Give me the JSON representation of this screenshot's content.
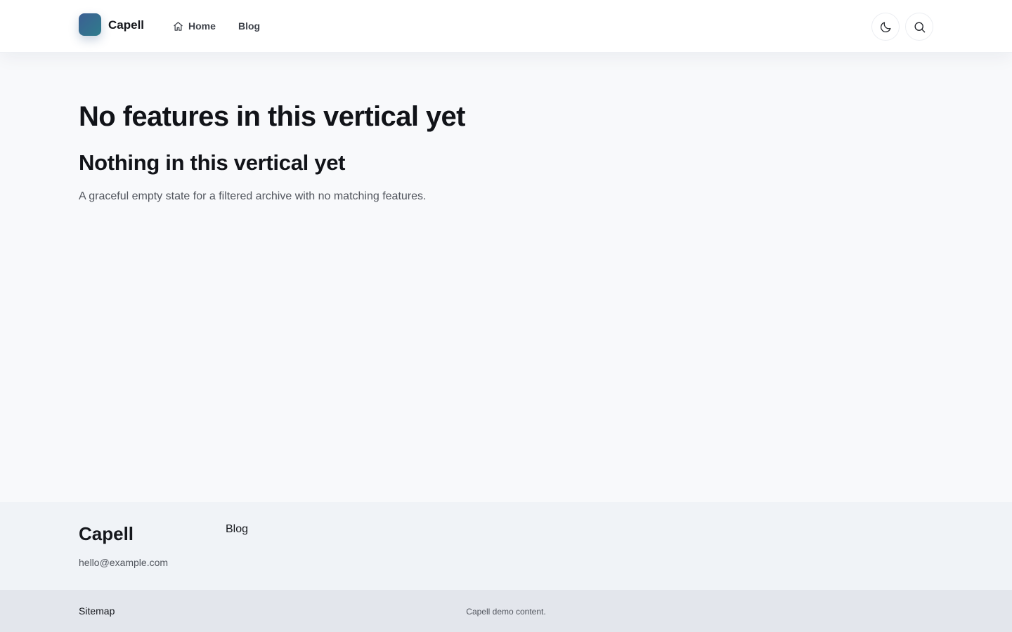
{
  "header": {
    "brand": "Capell",
    "nav": {
      "home_label": "Home",
      "blog_label": "Blog"
    },
    "icons": {
      "logo": "brand-logo",
      "home": "home-icon",
      "theme": "moon-icon",
      "search": "search-icon"
    }
  },
  "main": {
    "title": "No features in this vertical yet",
    "subtitle": "Nothing in this vertical yet",
    "description": "A graceful empty state for a filtered archive with no matching features."
  },
  "footer": {
    "brand": "Capell",
    "email": "hello@example.com",
    "blog_label": "Blog",
    "sitemap_label": "Sitemap",
    "copyright": "Capell demo content."
  },
  "colors": {
    "logo_gradient_start": "#3c5f93",
    "logo_gradient_end": "#2f7c8c",
    "page_background": "#f8f9fb",
    "footer_background": "#f0f3f7",
    "bottom_bar_background": "#e3e6ec"
  }
}
